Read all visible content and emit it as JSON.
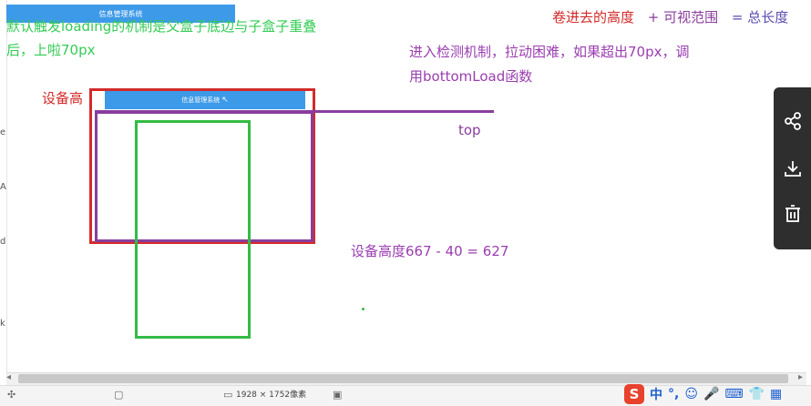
{
  "app": {
    "title": "信息管理系统"
  },
  "notes": {
    "green_line1": "默认触发loading的机制是父盒子底边与子盒子重叠",
    "green_line2": "后，上啦70px",
    "formula_part1": "卷进去的高度",
    "formula_plus": "+ 可视范围",
    "formula_eq": "= 总长度",
    "purple_line1": "进入检测机制，拉动困难，如果超出70px，调",
    "purple_line2": "用bottomLoad函数",
    "device_height": "设备高",
    "top": "top",
    "calc": "设备高度667 - 40 = 627"
  },
  "left_marks": [
    "e",
    "A",
    "d",
    "k"
  ],
  "statusbar": {
    "dimensions": "1928 × 1752像素"
  },
  "float_panel": {
    "icons": [
      "share-icon",
      "download-icon",
      "trash-icon"
    ]
  },
  "ime": {
    "logo": "S",
    "items": [
      "中",
      "°,",
      "☺",
      "🎤",
      "⌨",
      "👕",
      "▦"
    ]
  },
  "colors": {
    "green": "#33bb44",
    "red": "#d42a2a",
    "purple": "#8a3d9d",
    "appbar": "#3d9ae8"
  }
}
